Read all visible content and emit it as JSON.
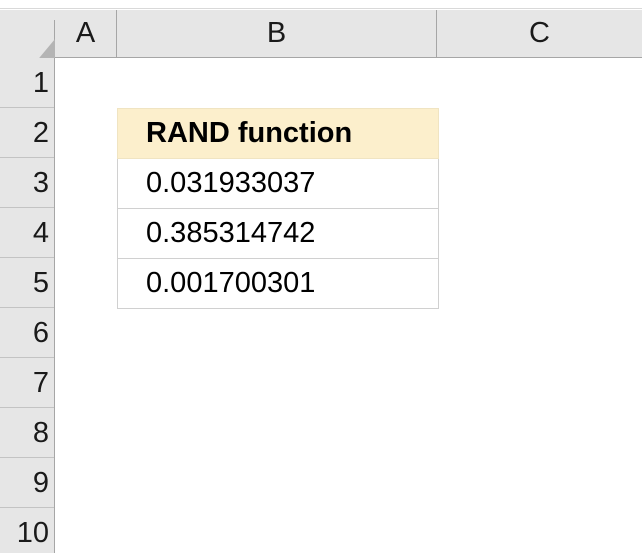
{
  "spreadsheet": {
    "select_all_icon": "select-all-triangle-icon",
    "column_headers": [
      "A",
      "B",
      "C"
    ],
    "row_headers": [
      "1",
      "2",
      "3",
      "4",
      "5",
      "6",
      "7",
      "8",
      "9",
      "10"
    ],
    "colors": {
      "header_background": "#e6e6e6",
      "header_text": "#1a1a1a",
      "gridline": "#d0d0d0",
      "highlight_cell_background": "#fcefcc",
      "cell_text": "#000000",
      "sheet_background": "#ffffff"
    }
  },
  "table": {
    "anchor_column": "B",
    "title_cell": {
      "reference": "B2",
      "text": "RAND function",
      "bold": true
    },
    "value_cells": [
      {
        "reference": "B3",
        "text": "0.031933037"
      },
      {
        "reference": "B4",
        "text": "0.385314742"
      },
      {
        "reference": "B5",
        "text": "0.001700301"
      }
    ]
  }
}
